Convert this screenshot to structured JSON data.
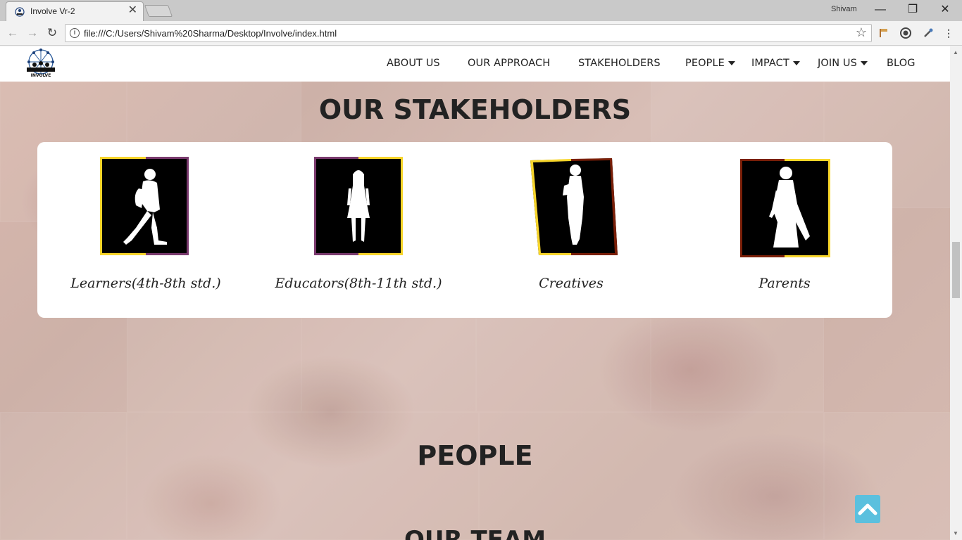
{
  "browser": {
    "tab_title": "Involve Vr-2",
    "tab_close": "✕",
    "profile_name": "Shivam",
    "url": "file:///C:/Users/Shivam%20Sharma/Desktop/Involve/index.html",
    "back": "←",
    "forward": "→",
    "reload": "↻",
    "minimize": "—",
    "restore": "❐",
    "close": "✕",
    "star": "☆"
  },
  "nav": {
    "logo_text": "INVOLVE",
    "items": [
      {
        "label": "ABOUT US",
        "dropdown": false
      },
      {
        "label": "OUR APPROACH",
        "dropdown": false
      },
      {
        "label": "STAKEHOLDERS",
        "dropdown": false
      },
      {
        "label": "PEOPLE",
        "dropdown": true
      },
      {
        "label": "IMPACT",
        "dropdown": true
      },
      {
        "label": "JOIN US",
        "dropdown": true
      },
      {
        "label": "BLOG",
        "dropdown": false
      }
    ]
  },
  "stakeholders": {
    "title": "OUR STAKEHOLDERS",
    "items": [
      {
        "label": "Learners(4th-8th std.)",
        "icon": "walking-student-icon"
      },
      {
        "label": "Educators(8th-11th std.)",
        "icon": "standing-girl-icon"
      },
      {
        "label": "Creatives",
        "icon": "woman-holding-book-icon"
      },
      {
        "label": "Parents",
        "icon": "woman-in-saree-icon"
      }
    ]
  },
  "people": {
    "title": "PEOPLE",
    "subtitle": "OUR TEAM"
  },
  "colors": {
    "accent_yellow": "#f7d52a",
    "accent_purple": "#7a3a6e",
    "accent_brown": "#7a1f08",
    "scroll_button": "#5bc0de"
  }
}
